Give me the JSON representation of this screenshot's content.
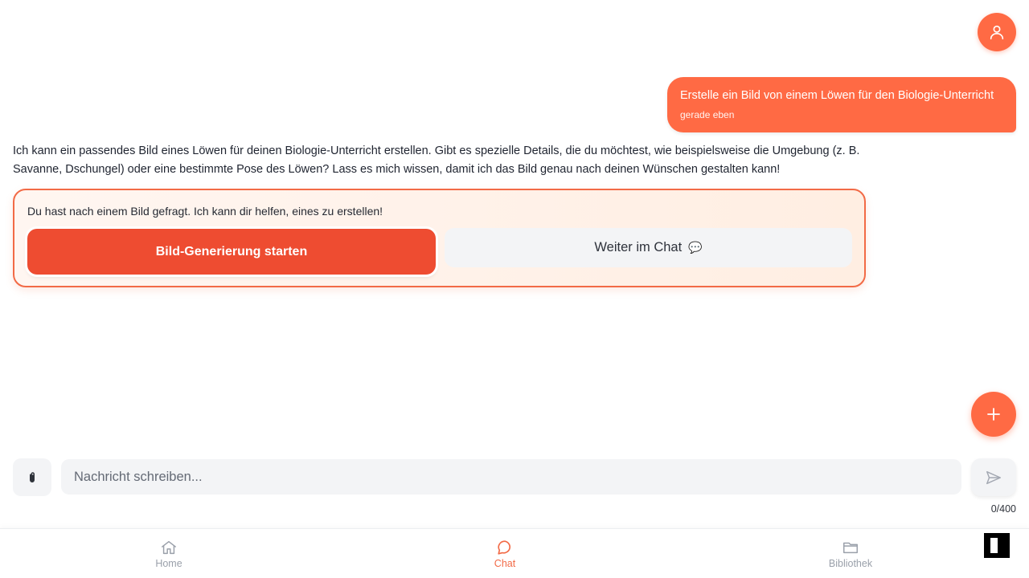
{
  "conversation": {
    "user_message": {
      "text": "Erstelle ein Bild von einem Löwen für den Biologie-Unterricht",
      "time": "gerade eben"
    },
    "assistant_message": {
      "text": "Ich kann ein passendes Bild eines Löwen für deinen Biologie-Unterricht erstellen. Gibt es spezielle Details, die du möchtest, wie beispielsweise die Umgebung (z. B. Savanne, Dschungel) oder eine bestimmte Pose des Löwen? Lass es mich wissen, damit ich das Bild genau nach deinen Wünschen gestalten kann!"
    },
    "suggestion": {
      "prompt": "Du hast nach einem Bild gefragt. Ich kann dir helfen, eines zu erstellen!",
      "primary_label": "Bild-Generierung starten",
      "secondary_label": "Weiter im Chat",
      "secondary_icon": "💬"
    }
  },
  "composer": {
    "placeholder": "Nachricht schreiben...",
    "value": "",
    "char_count": "0/400"
  },
  "nav": {
    "items": [
      {
        "label": "Home",
        "icon": "home-icon"
      },
      {
        "label": "Chat",
        "icon": "chat-bubble-icon",
        "active": true
      },
      {
        "label": "Bibliothek",
        "icon": "folder-icon"
      }
    ]
  },
  "colors": {
    "accent": "#ff6a44",
    "primary_button": "#ee4c31",
    "active_nav": "#f26a46",
    "inactive_nav": "#9aa0aa",
    "input_bg": "#f3f4f6"
  },
  "icons": {
    "profile": "user-icon",
    "add": "plus-icon",
    "attach": "paperclip-icon",
    "send": "send-icon"
  }
}
